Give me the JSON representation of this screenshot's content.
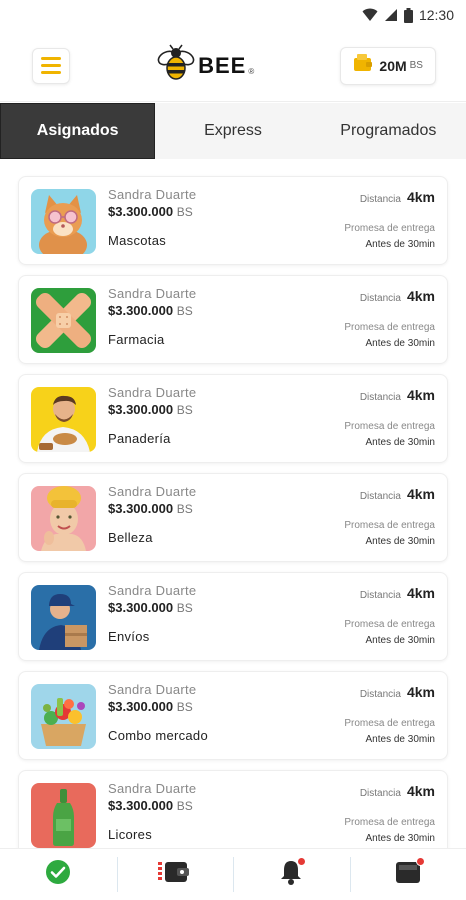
{
  "status_bar": {
    "time": "12:30"
  },
  "header": {
    "logo_text": "BEE",
    "logo_mark": "®",
    "wallet_amount": "20M",
    "wallet_currency": "BS"
  },
  "tabs": [
    {
      "label": "Asignados",
      "active": true
    },
    {
      "label": "Express",
      "active": false
    },
    {
      "label": "Programados",
      "active": false
    }
  ],
  "orders": [
    {
      "client": "Sandra Duarte",
      "price": "$3.300.000",
      "currency": "BS",
      "category": "Mascotas",
      "distance_label": "Distancia",
      "distance": "4km",
      "promise_label": "Promesa de entrega",
      "promise": "Antes de 30min",
      "image": "cat-image"
    },
    {
      "client": "Sandra Duarte",
      "price": "$3.300.000",
      "currency": "BS",
      "category": "Farmacia",
      "distance_label": "Distancia",
      "distance": "4km",
      "promise_label": "Promesa de entrega",
      "promise": "Antes de 30min",
      "image": "bandage-image"
    },
    {
      "client": "Sandra Duarte",
      "price": "$3.300.000",
      "currency": "BS",
      "category": "Panadería",
      "distance_label": "Distancia",
      "distance": "4km",
      "promise_label": "Promesa de entrega",
      "promise": "Antes de 30min",
      "image": "baker-image"
    },
    {
      "client": "Sandra Duarte",
      "price": "$3.300.000",
      "currency": "BS",
      "category": "Belleza",
      "distance_label": "Distancia",
      "distance": "4km",
      "promise_label": "Promesa de entrega",
      "promise": "Antes de 30min",
      "image": "spa-woman-image"
    },
    {
      "client": "Sandra Duarte",
      "price": "$3.300.000",
      "currency": "BS",
      "category": "Envíos",
      "distance_label": "Distancia",
      "distance": "4km",
      "promise_label": "Promesa de entrega",
      "promise": "Antes de 30min",
      "image": "courier-image"
    },
    {
      "client": "Sandra Duarte",
      "price": "$3.300.000",
      "currency": "BS",
      "category": "Combo mercado",
      "distance_label": "Distancia",
      "distance": "4km",
      "promise_label": "Promesa de entrega",
      "promise": "Antes de 30min",
      "image": "groceries-image"
    },
    {
      "client": "Sandra Duarte",
      "price": "$3.300.000",
      "currency": "BS",
      "category": "Licores",
      "distance_label": "Distancia",
      "distance": "4km",
      "promise_label": "Promesa de entrega",
      "promise": "Antes de 30min",
      "image": "bottle-image"
    }
  ],
  "bottom_nav": [
    {
      "icon": "check-circle-icon"
    },
    {
      "icon": "wallet-icon"
    },
    {
      "icon": "bell-icon",
      "badge": true
    },
    {
      "icon": "inbox-icon",
      "badge": true
    }
  ],
  "colors": {
    "brand_yellow": "#f0b400",
    "active_tab": "#3a3a3a",
    "success_green": "#2eaa3f",
    "badge_red": "#e53935"
  }
}
